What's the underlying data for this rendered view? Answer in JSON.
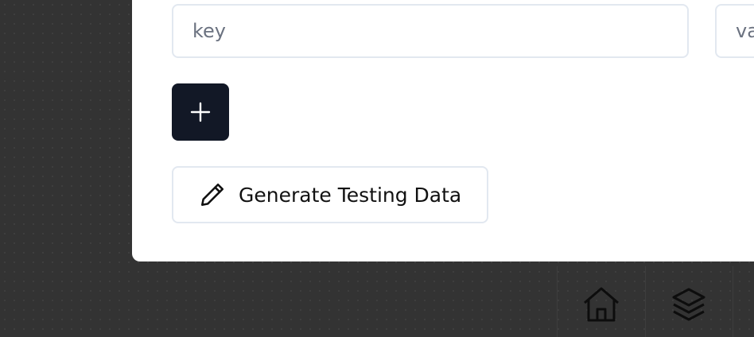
{
  "form": {
    "key_placeholder": "key",
    "value_placeholder": "value",
    "add_button_symbol": "+",
    "add_button_icon": "plus-icon",
    "generate_button_label": "Generate Testing Data",
    "generate_button_icon": "pencil-icon"
  },
  "dock": {
    "items": [
      {
        "icon": "home-icon"
      },
      {
        "icon": "layers-icon"
      }
    ]
  },
  "colors": {
    "canvas_background": "#333333",
    "card_background": "#ffffff",
    "primary_button": "#121826",
    "border": "#e2e8f0",
    "placeholder_text": "#6b7280"
  }
}
